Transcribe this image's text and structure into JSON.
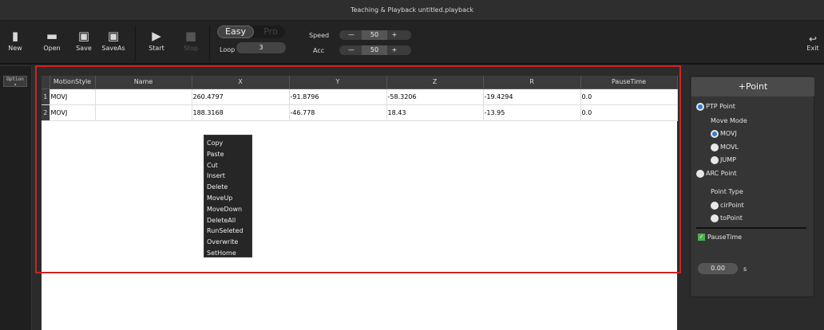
{
  "window": {
    "title": "Teaching & Playback  untitled.playback"
  },
  "toolbar": {
    "buttons": [
      {
        "label": "New",
        "icon": "new-file-icon"
      },
      {
        "label": "Open",
        "icon": "folder-icon"
      },
      {
        "label": "Save",
        "icon": "save-icon"
      },
      {
        "label": "SaveAs",
        "icon": "save-as-icon"
      },
      {
        "label": "Start",
        "icon": "play-icon"
      },
      {
        "label": "Stop",
        "icon": "stop-icon"
      }
    ],
    "mode_easy": "Easy",
    "mode_pro": "Pro",
    "loop_label": "Loop",
    "loop_value": "3",
    "speed_label": "Speed",
    "speed_value": "50",
    "acc_label": "Acc",
    "acc_value": "50",
    "minus": "—",
    "plus": "+",
    "exit_label": "Exit"
  },
  "sidebar": {
    "option_label": "Option"
  },
  "table": {
    "columns": [
      "MotionStyle",
      "Name",
      "X",
      "Y",
      "Z",
      "R",
      "PauseTime"
    ],
    "rows": [
      {
        "num": "1",
        "style": "MOVJ",
        "name": "",
        "x": "260.4797",
        "y": "-91.8796",
        "z": "-58.3206",
        "r": "-19.4294",
        "pause": "0.0"
      },
      {
        "num": "2",
        "style": "MOVJ",
        "name": "",
        "x": "188.3168",
        "y": "-46.778",
        "z": "18.43",
        "r": "-13.95",
        "pause": "0.0"
      }
    ]
  },
  "context_menu": [
    "Copy",
    "Paste",
    "Cut",
    "Insert",
    "Delete",
    "MoveUp",
    "MoveDown",
    "DeleteAll",
    "RunSeleted",
    "Overwrite",
    "SetHome"
  ],
  "right_panel": {
    "add_point": "+Point",
    "ptp_point": "PTP Point",
    "move_mode": "Move Mode",
    "movj": "MOVJ",
    "movl": "MOVL",
    "jump": "JUMP",
    "arc_point": "ARC Point",
    "point_type": "Point Type",
    "cir_point": "cirPoint",
    "to_point": "toPoint",
    "pause_time": "PauseTime",
    "pause_value": "0.00",
    "unit": "s"
  },
  "colors": {
    "highlight": "#d22222",
    "radio_selected": "#2f7fd8",
    "check": "#4caf50"
  }
}
